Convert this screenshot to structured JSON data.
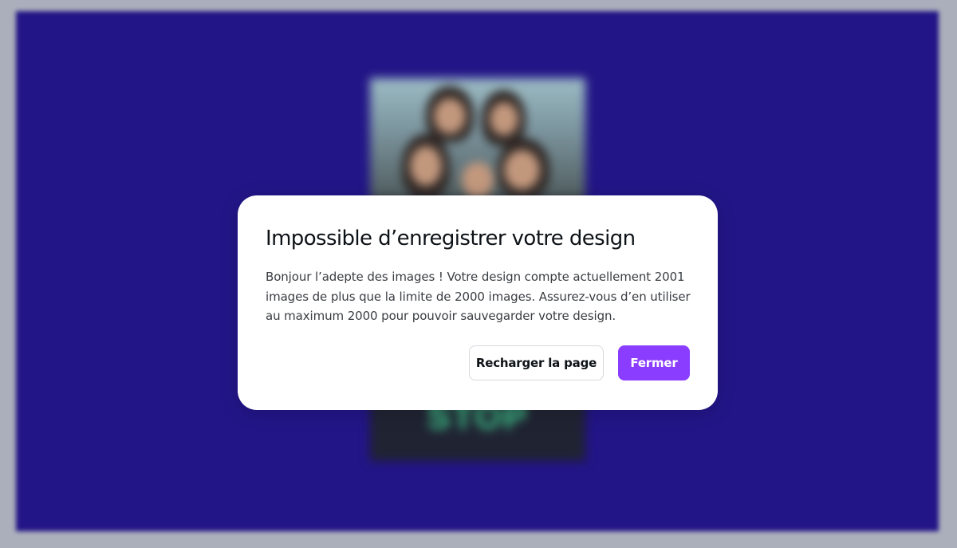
{
  "background": {
    "canvas_color": "#1e1087",
    "poster_text": "STOP"
  },
  "dialog": {
    "title": "Impossible d’enregistrer votre design",
    "body": "Bonjour l’adepte des images ! Votre design compte actuellement 2001 images de plus que la limite de 2000 images. Assurez-vous d’en utiliser au maximum 2000 pour pouvoir sauvegarder votre design.",
    "buttons": {
      "reload_label": "Recharger la page",
      "close_label": "Fermer"
    },
    "colors": {
      "primary_button": "#8b3dff"
    }
  }
}
